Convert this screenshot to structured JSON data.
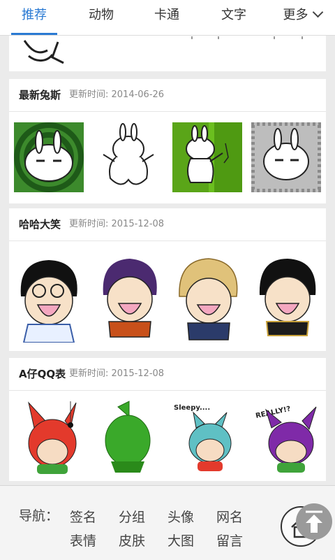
{
  "tabs": [
    {
      "label": "推荐",
      "active": true
    },
    {
      "label": "动物",
      "active": false
    },
    {
      "label": "卡通",
      "active": false
    },
    {
      "label": "文字",
      "active": false
    },
    {
      "label": "更多",
      "active": false
    }
  ],
  "sections": [
    {
      "title": "最新兔斯",
      "time": "更新时间: 2014-06-26"
    },
    {
      "title": "哈哈大笑",
      "time": "更新时间: 2015-12-08"
    },
    {
      "title": "A仔QQ表",
      "time": "更新时间: 2015-12-08"
    }
  ],
  "stickers": {
    "text_sleepy": "Sleepy....",
    "text_really": "REALLY!?"
  },
  "bottom_nav": {
    "label": "导航：",
    "links": [
      "签名",
      "分组",
      "头像",
      "网名",
      "表情",
      "皮肤",
      "大图",
      "留言"
    ]
  },
  "colors": {
    "accent": "#2a7ad3",
    "green": "#6bbf1f",
    "red_rabbit": "#e33a2c",
    "teal_rabbit": "#5fc0c4",
    "purple_rabbit": "#7f2aa8"
  }
}
